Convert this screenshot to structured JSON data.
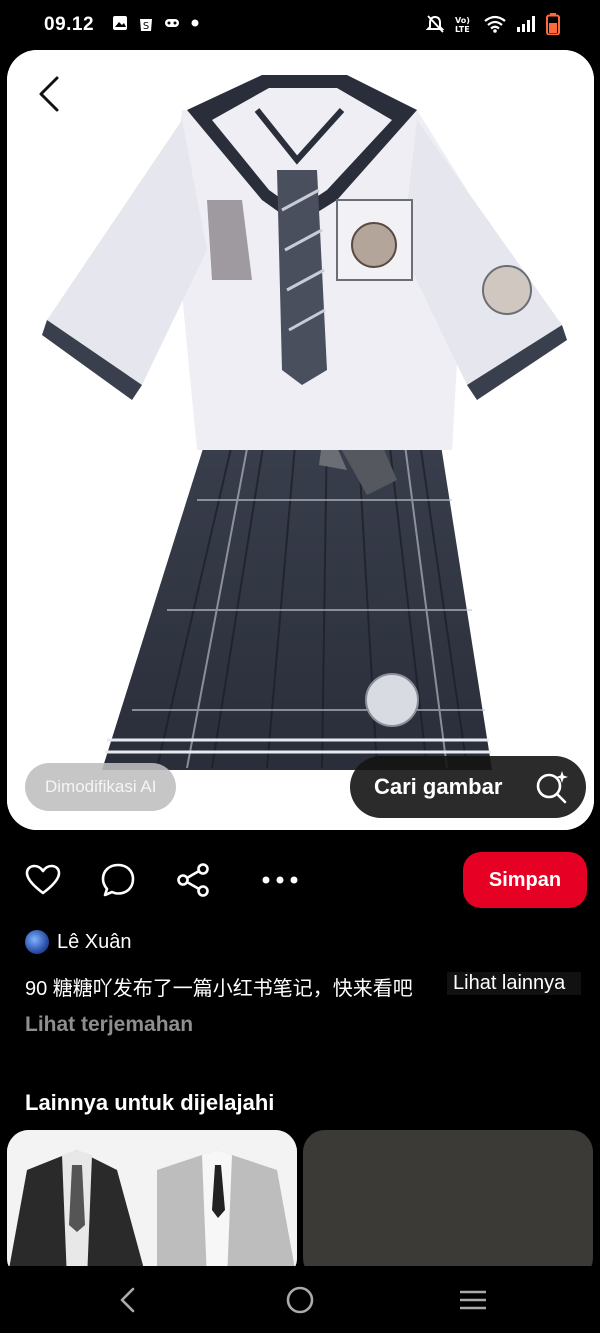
{
  "status_bar": {
    "time": "09.12",
    "left_icons": [
      "gallery-icon",
      "shop-icon",
      "game-icon",
      "dot-icon"
    ],
    "right_icons": [
      "mute-icon",
      "volte-icon",
      "wifi-icon",
      "signal-icon",
      "battery-icon"
    ]
  },
  "pin": {
    "image_icon": "school-uniform-illustration",
    "ai_badge": "Dimodifikasi AI",
    "search_image_label": "Cari gambar"
  },
  "actions": {
    "icons": [
      "heart-icon",
      "comment-icon",
      "share-icon",
      "more-icon"
    ],
    "save_label": "Simpan",
    "save_color": "#e60023"
  },
  "author": {
    "name": "Lê Xuân"
  },
  "description": {
    "text": "90 糖糖吖发布了一篇小红书笔记，快来看吧",
    "see_more": "Lihat lainnya",
    "translate": "Lihat terjemahan"
  },
  "explore": {
    "heading": "Lainnya untuk dijelajahi"
  },
  "nav": {
    "icons": [
      "back-nav-icon",
      "home-nav-icon",
      "recents-nav-icon"
    ]
  }
}
